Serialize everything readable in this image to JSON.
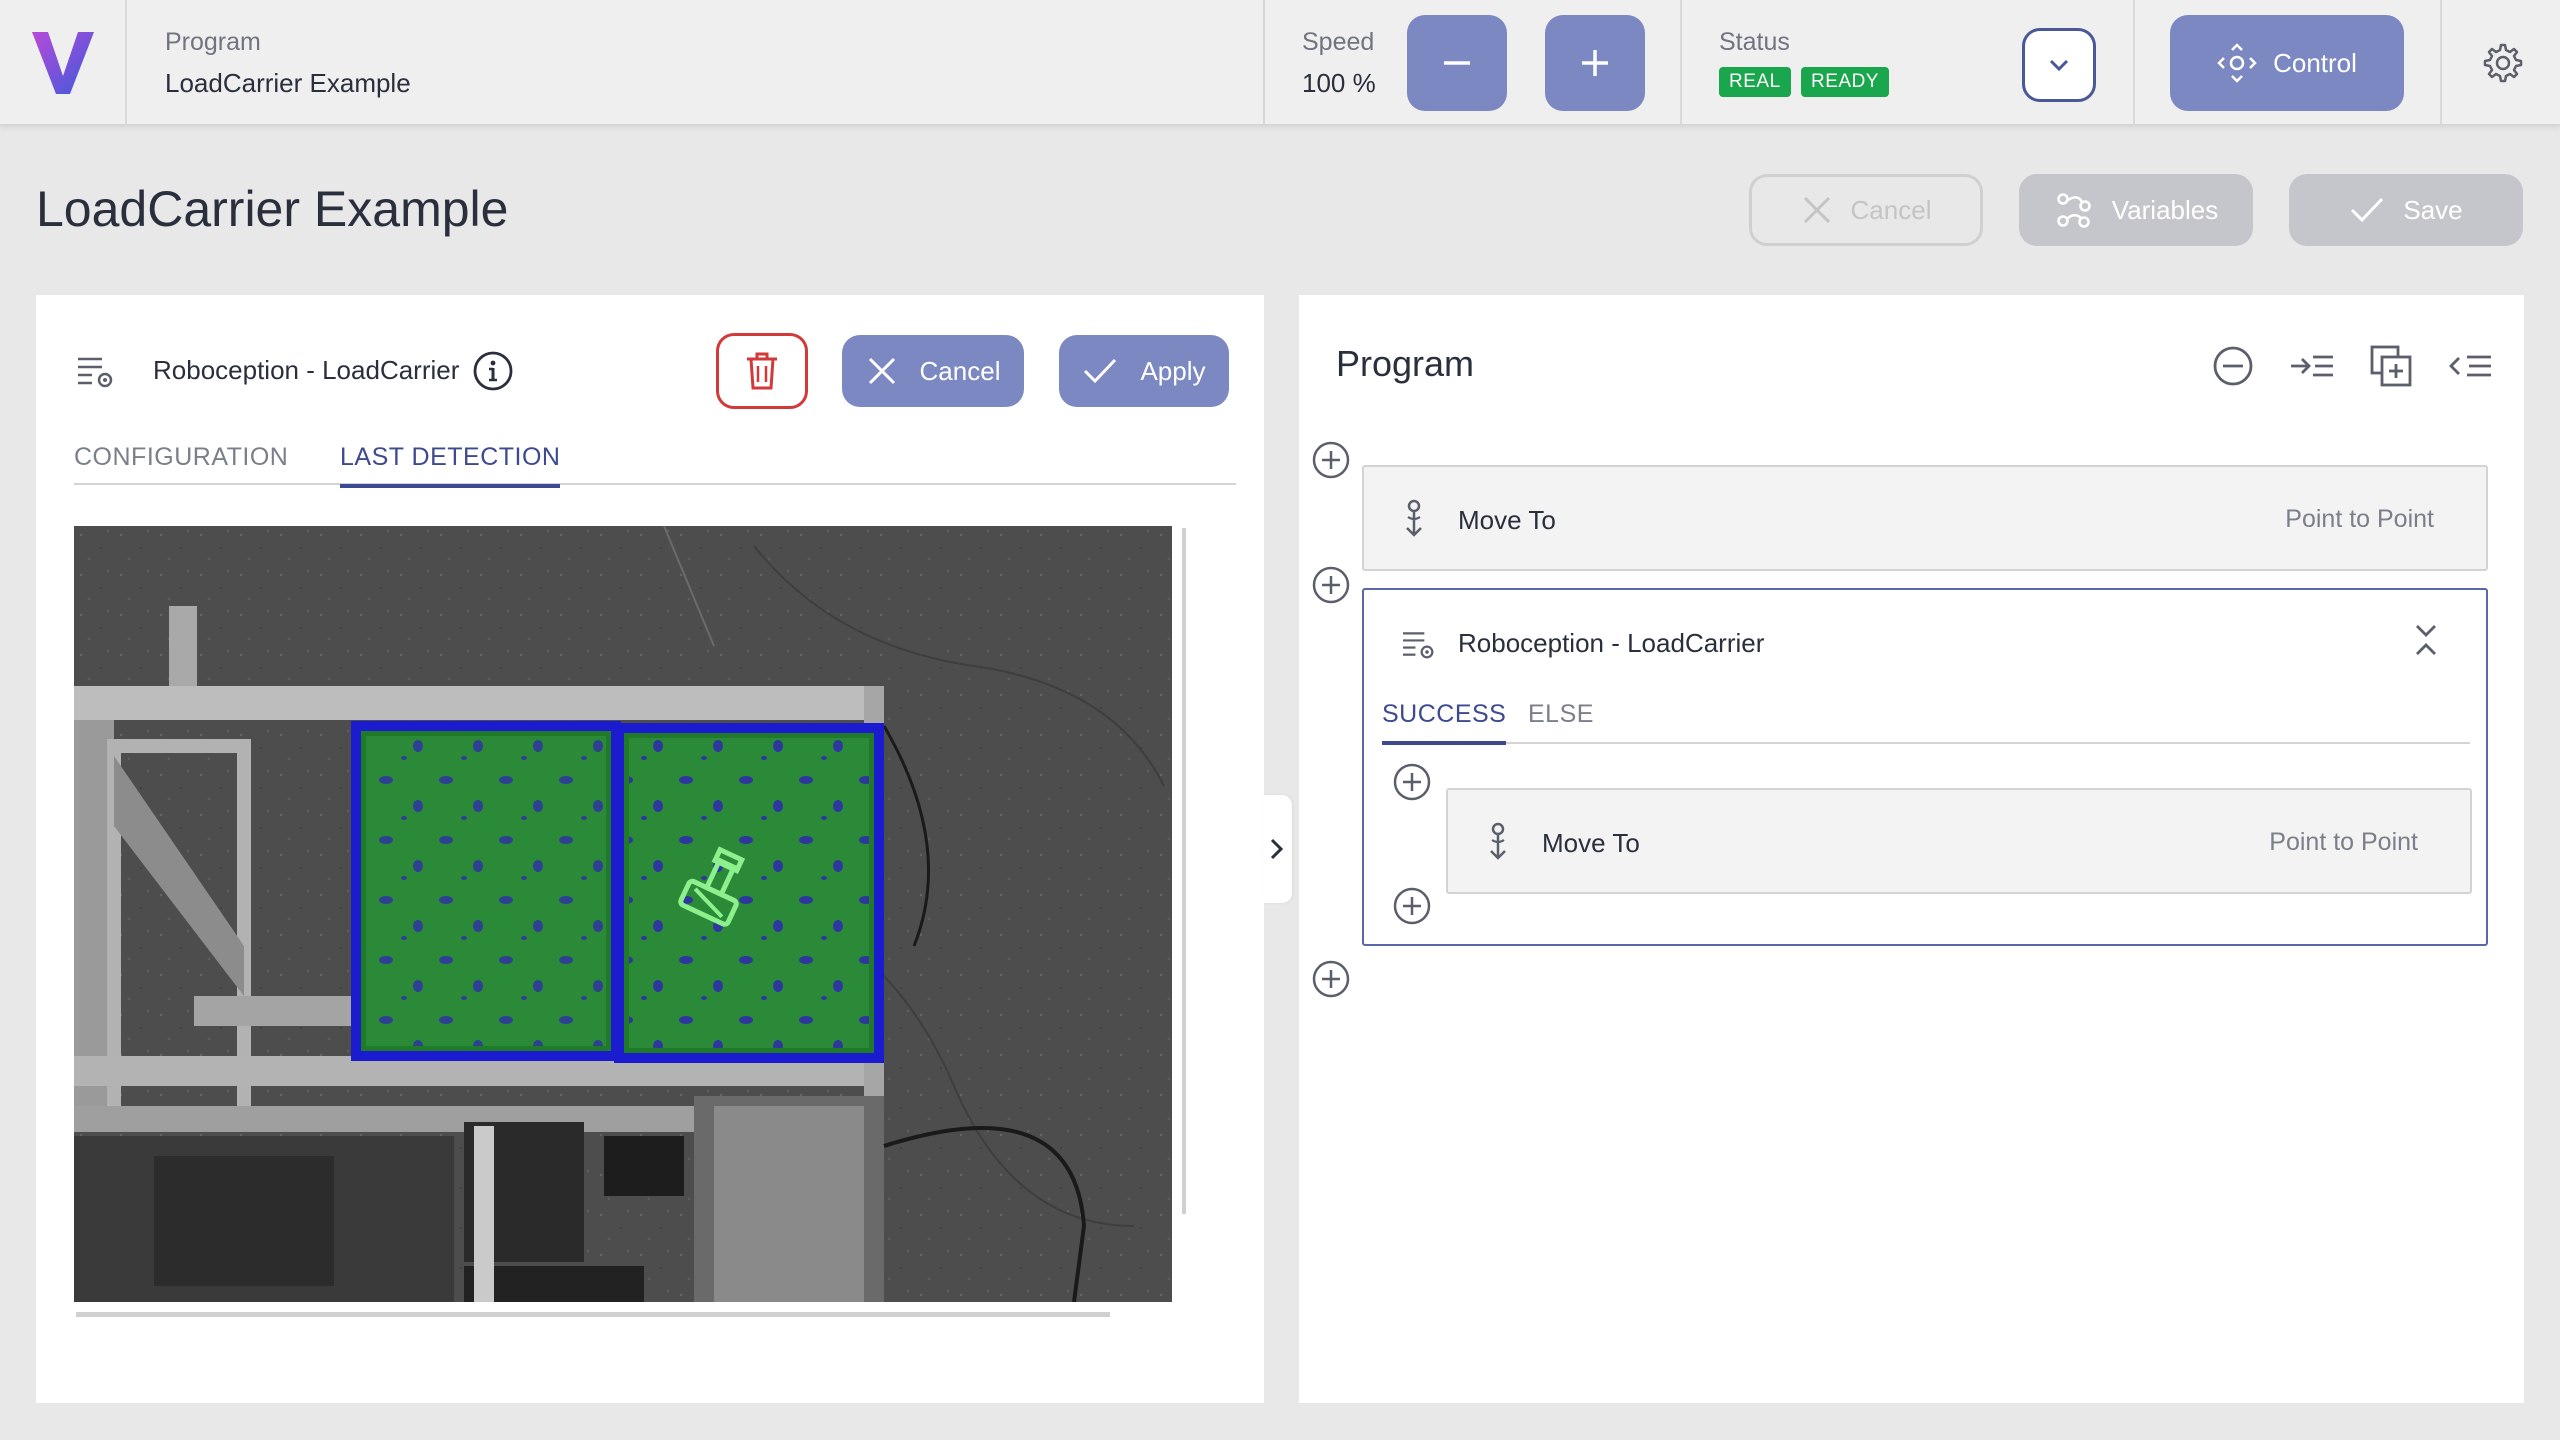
{
  "topbar": {
    "program_label": "Program",
    "program_name": "LoadCarrier Example",
    "speed_label": "Speed",
    "speed_value": "100 %",
    "status_label": "Status",
    "status_badges": [
      "REAL",
      "READY"
    ],
    "control_label": "Control",
    "logo_gradient": [
      "#3b5bdb",
      "#b84ad8"
    ]
  },
  "page": {
    "title": "LoadCarrier Example",
    "cancel_label": "Cancel",
    "variables_label": "Variables",
    "save_label": "Save"
  },
  "node_editor": {
    "title": "Roboception - LoadCarrier",
    "cancel_label": "Cancel",
    "apply_label": "Apply",
    "tabs": [
      "CONFIGURATION",
      "LAST DETECTION"
    ],
    "active_tab": "LAST DETECTION"
  },
  "program_panel": {
    "title": "Program",
    "steps": [
      {
        "label": "Move To",
        "type": "Point to Point"
      },
      {
        "label": "Roboception - LoadCarrier"
      }
    ],
    "branch_tabs": [
      "SUCCESS",
      "ELSE"
    ],
    "active_branch": "SUCCESS",
    "branch_steps": [
      {
        "label": "Move To",
        "type": "Point to Point"
      }
    ]
  },
  "colors": {
    "accent": "#7b88c2",
    "accent_dark": "#3d4a8f",
    "badge_green": "#1aa64c",
    "danger": "#d23a3a",
    "disabled": "#c5c6cb"
  }
}
